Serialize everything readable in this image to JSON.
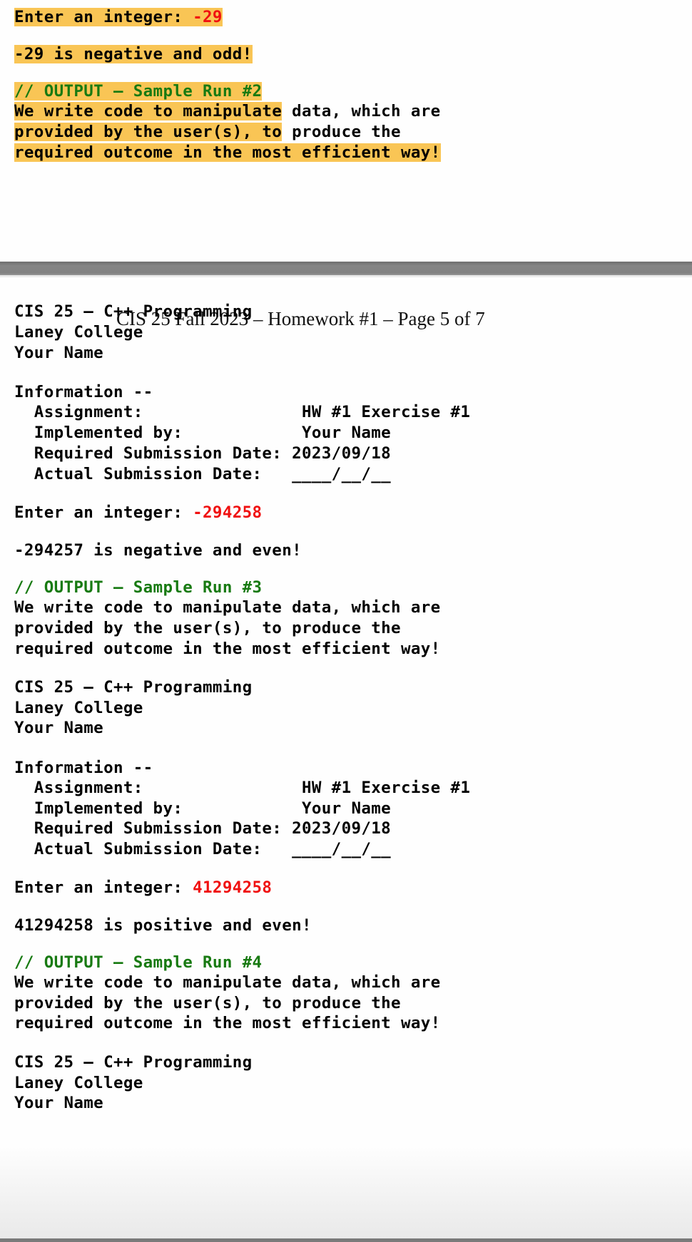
{
  "top_page": {
    "prompt_label": "Enter an integer: ",
    "prompt_value": "-29",
    "result": "-29 is negative and odd!",
    "comment": "// OUTPUT – Sample Run #2",
    "paragraph": {
      "l1_hl": "We write code to manipulate",
      "l1_rest": " data, which are",
      "l2_hl": "provided by the user(s), to",
      "l2_rest": " produce the",
      "l3_hl": "required outcome in the most efficient way!"
    }
  },
  "page_header": "CIS 25 Fall 2023 – Homework #1 – Page 5 of 7",
  "runs": [
    {
      "course": "CIS 25 – C++ Programming",
      "college": "Laney College",
      "name": "Your Name",
      "info_header": "Information --",
      "assignment": "  Assignment:                HW #1 Exercise #1",
      "implemented": "  Implemented by:            Your Name",
      "required_date": "  Required Submission Date: 2023/09/18",
      "actual_date": "  Actual Submission Date:   ____/__/__",
      "prompt_label": "Enter an integer: ",
      "prompt_value": "-294258",
      "result": "-294257 is negative and even!",
      "comment": "// OUTPUT – Sample Run #3",
      "p1": "We write code to manipulate data, which are",
      "p2": "provided by the user(s), to produce the",
      "p3": "required outcome in the most efficient way!"
    },
    {
      "course": "CIS 25 – C++ Programming",
      "college": "Laney College",
      "name": "Your Name",
      "info_header": "Information --",
      "assignment": "  Assignment:                HW #1 Exercise #1",
      "implemented": "  Implemented by:            Your Name",
      "required_date": "  Required Submission Date: 2023/09/18",
      "actual_date": "  Actual Submission Date:   ____/__/__",
      "prompt_label": "Enter an integer: ",
      "prompt_value": "41294258",
      "result": "41294258 is positive and even!",
      "comment": "// OUTPUT – Sample Run #4",
      "p1": "We write code to manipulate data, which are",
      "p2": "provided by the user(s), to produce the",
      "p3": "required outcome in the most efficient way!"
    },
    {
      "course": "CIS 25 – C++ Programming",
      "college": "Laney College",
      "name": "Your Name"
    }
  ],
  "colors": {
    "highlight": "#f9c555",
    "input_value": "#f01010",
    "comment": "#187a12"
  }
}
